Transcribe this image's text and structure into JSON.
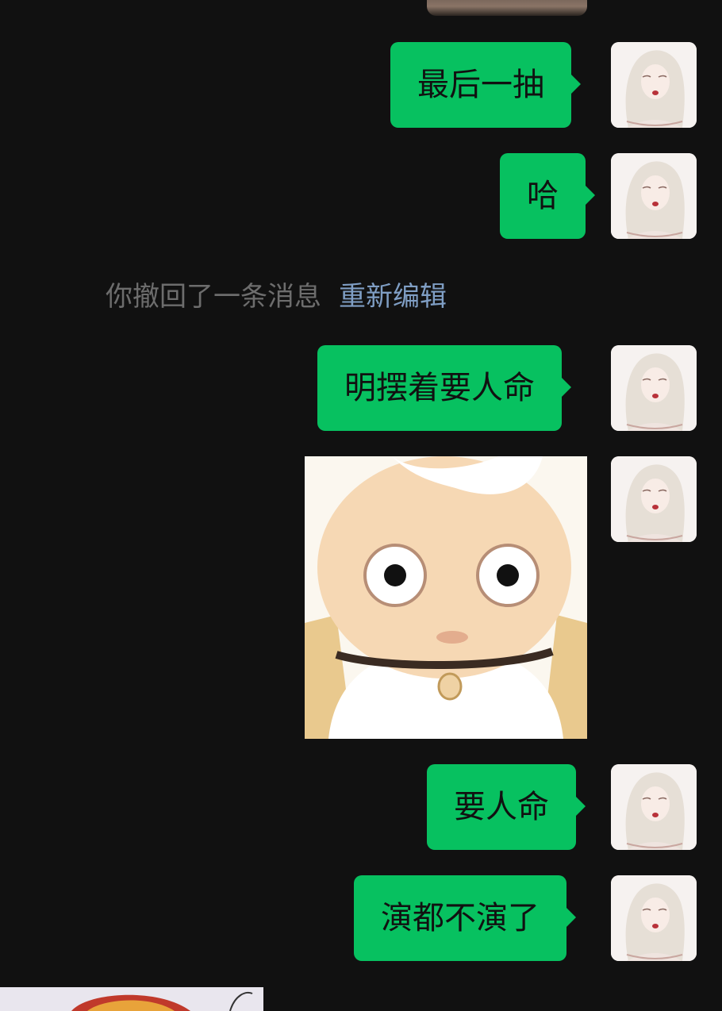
{
  "messages": [
    {
      "type": "text",
      "text": "最后一抽"
    },
    {
      "type": "text",
      "text": "哈"
    },
    {
      "type": "text",
      "text": "明摆着要人命"
    },
    {
      "type": "sticker",
      "icon": "wide-eyed-baby-sticker"
    },
    {
      "type": "text",
      "text": "要人命"
    },
    {
      "type": "text",
      "text": "演都不演了"
    }
  ],
  "recall_notice": {
    "text": "你撤回了一条消息",
    "action": "重新编辑"
  },
  "colors": {
    "bubble": "#07c160",
    "background": "#111111",
    "link": "#7f9ec4"
  }
}
